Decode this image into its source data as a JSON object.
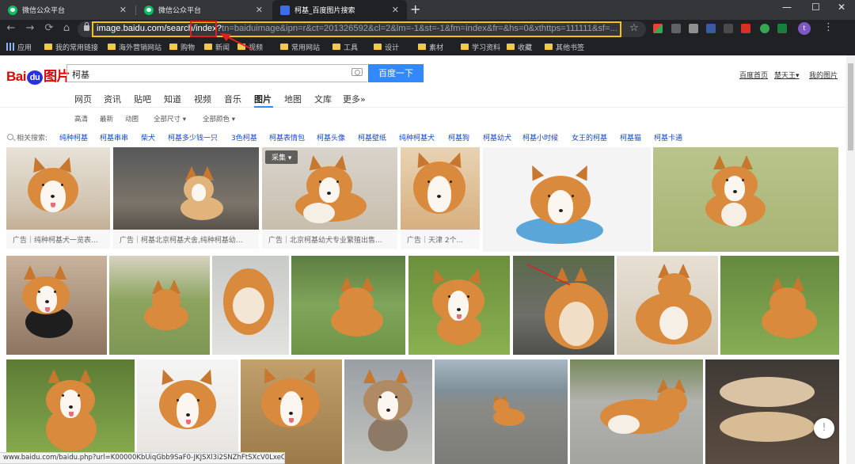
{
  "browser": {
    "tabs": [
      {
        "title": "微信公众平台",
        "active": false,
        "favicon": "wechat-icon"
      },
      {
        "title": "微信公众平台",
        "active": false,
        "favicon": "wechat-icon"
      },
      {
        "title": "柯基_百度图片搜索",
        "active": true,
        "favicon": "baidu-icon"
      }
    ],
    "new_tab": "+",
    "window_controls": {
      "minimize": "—",
      "maximize": "☐",
      "close": "✕"
    },
    "nav": {
      "back": "←",
      "forward": "→",
      "reload": "⟳",
      "home": "⌂"
    },
    "url": {
      "host": "image.baidu.com/search/",
      "path": "index?",
      "query": "tn=baiduimage&ipn=r&ct=201326592&cl=2&lm=-1&st=-1&fm=index&fr=&hs=0&xthttps=111111&sf=..."
    },
    "bookmark_star": "☆",
    "profile_initial": "t",
    "menu": "⋮",
    "bookmarks": [
      "应用",
      "我的常用链接",
      "海外营销网站",
      "购物",
      "新闻",
      "视频",
      "常用网站",
      "工具",
      "设计",
      "素材",
      "学习资料",
      "收藏",
      "其他书签"
    ]
  },
  "baidu": {
    "logo": {
      "bai": "Bai",
      "du": "du",
      "pic": "图片"
    },
    "query": "柯基",
    "search_button": "百度一下",
    "top_links": [
      "百度首页",
      "楚天王▾",
      "我的图片"
    ],
    "nav_tabs": [
      "网页",
      "资讯",
      "贴吧",
      "知道",
      "视频",
      "音乐",
      "图片",
      "地图",
      "文库",
      "更多»"
    ],
    "active_tab": "图片",
    "filters": [
      "高清",
      "最新",
      "动图",
      "全部尺寸 ▾",
      "全部颜色 ▾"
    ],
    "related_label": "相关搜索:",
    "related": [
      "纯种柯基",
      "柯基串串",
      "柴犬",
      "柯基多少钱一只",
      "3色柯基",
      "柯基表情包",
      "柯基头像",
      "柯基壁纸",
      "纯种柯基犬",
      "柯基狗",
      "柯基幼犬",
      "柯基小时候",
      "女王的柯基",
      "柯基猫",
      "柯基卡通"
    ],
    "ads": [
      "广告｜纯种柯基犬一览表...",
      "广告｜柯基北京柯基犬舍,纯种柯基幼...",
      "广告｜北京柯基幼犬专业繁殖出售...",
      "广告｜天津 2个..."
    ],
    "collect_button": "采集 ▾",
    "feedback": "!",
    "status_url": "www.baidu.com/baidu.php?url=K00000KbUiqGbb9SaF0-JKJSXl3i2SNZhFtSXcV0LxeCx..."
  },
  "colors": {
    "chrome_dark": "#202124",
    "tabstrip": "#35363a",
    "baidu_red": "#e10602",
    "baidu_blue": "#2932e1",
    "search_button": "#3388ff",
    "link_blue": "#1a47c4",
    "annotation_red": "#e02020",
    "annotation_yellow": "#f1c40f"
  }
}
